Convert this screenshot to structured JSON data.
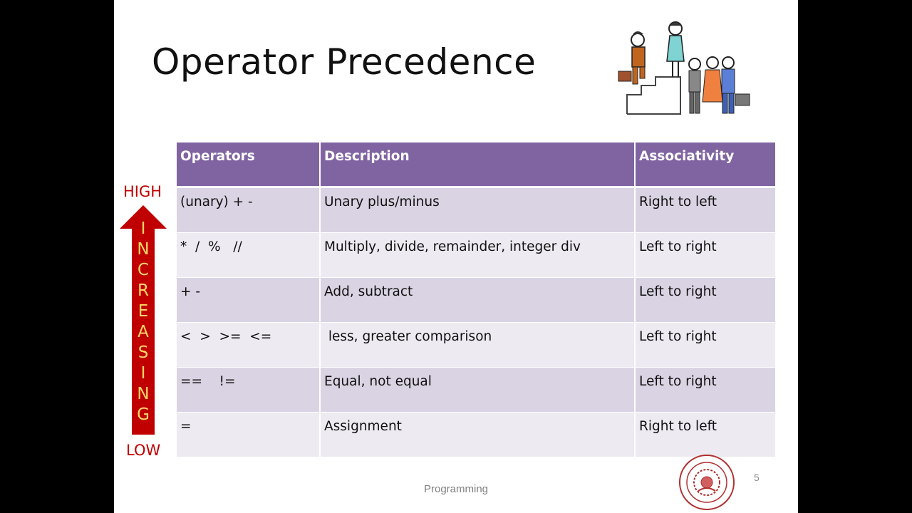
{
  "title": "Operator Precedence",
  "table": {
    "headers": [
      "Operators",
      "Description",
      "Associativity"
    ],
    "rows": [
      {
        "operators": "(unary) + -",
        "description": "Unary plus/minus",
        "associativity": "Right to left"
      },
      {
        "operators": "*  /  %   //",
        "description": "Multiply, divide, remainder, integer div",
        "associativity": "Left to right"
      },
      {
        "operators": "+ -",
        "description": "Add, subtract",
        "associativity": "Left to right"
      },
      {
        "operators": "<  >  >=  <=",
        "description": " less, greater comparison",
        "associativity": "Left to right"
      },
      {
        "operators": "==    !=",
        "description": "Equal, not equal",
        "associativity": "Left to right"
      },
      {
        "operators": "=",
        "description": "Assignment",
        "associativity": "Right to left"
      }
    ]
  },
  "precedence_arrow": {
    "high_label": "HIGH",
    "low_label": "LOW",
    "letters": [
      "I",
      "N",
      "C",
      "R",
      "E",
      "A",
      "S",
      "I",
      "N",
      "G"
    ]
  },
  "footer": "Programming",
  "page_number": "5",
  "colors": {
    "header": "#8064a2",
    "row_odd": "#d9d3e3",
    "row_even": "#edeaf1",
    "arrow": "#c00000",
    "arrow_text": "#ffd966"
  }
}
